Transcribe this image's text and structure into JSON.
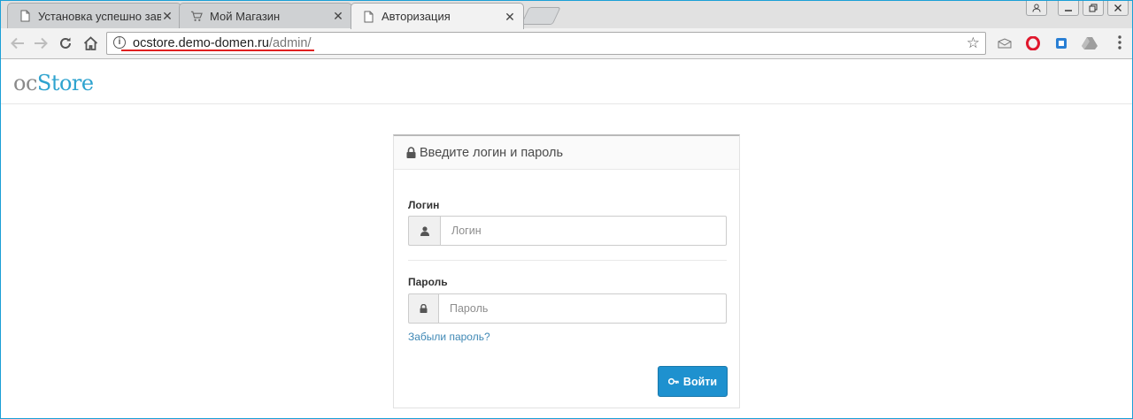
{
  "browser": {
    "tabs": [
      {
        "title": "Установка успешно заве",
        "icon": "page-icon",
        "active": false
      },
      {
        "title": "Мой Магазин",
        "icon": "cart-icon",
        "active": false
      },
      {
        "title": "Авторизация",
        "icon": "page-icon",
        "active": true
      }
    ],
    "close_glyph": "✕",
    "url_host": "ocstore.demo-domen.ru",
    "url_path": "/admin/",
    "colors": {
      "url_underline": "#e02020",
      "window_border": "#1a9fd6"
    }
  },
  "site": {
    "logo_oc": "oc",
    "logo_store": "Store",
    "brand_color": "#2ea3cf"
  },
  "login": {
    "heading": "Введите логин и пароль",
    "username_label": "Логин",
    "username_placeholder": "Логин",
    "password_label": "Пароль",
    "password_placeholder": "Пароль",
    "forgot_link": "Забыли пароль?",
    "submit_label": "Войти",
    "button_color": "#1e91cf"
  }
}
